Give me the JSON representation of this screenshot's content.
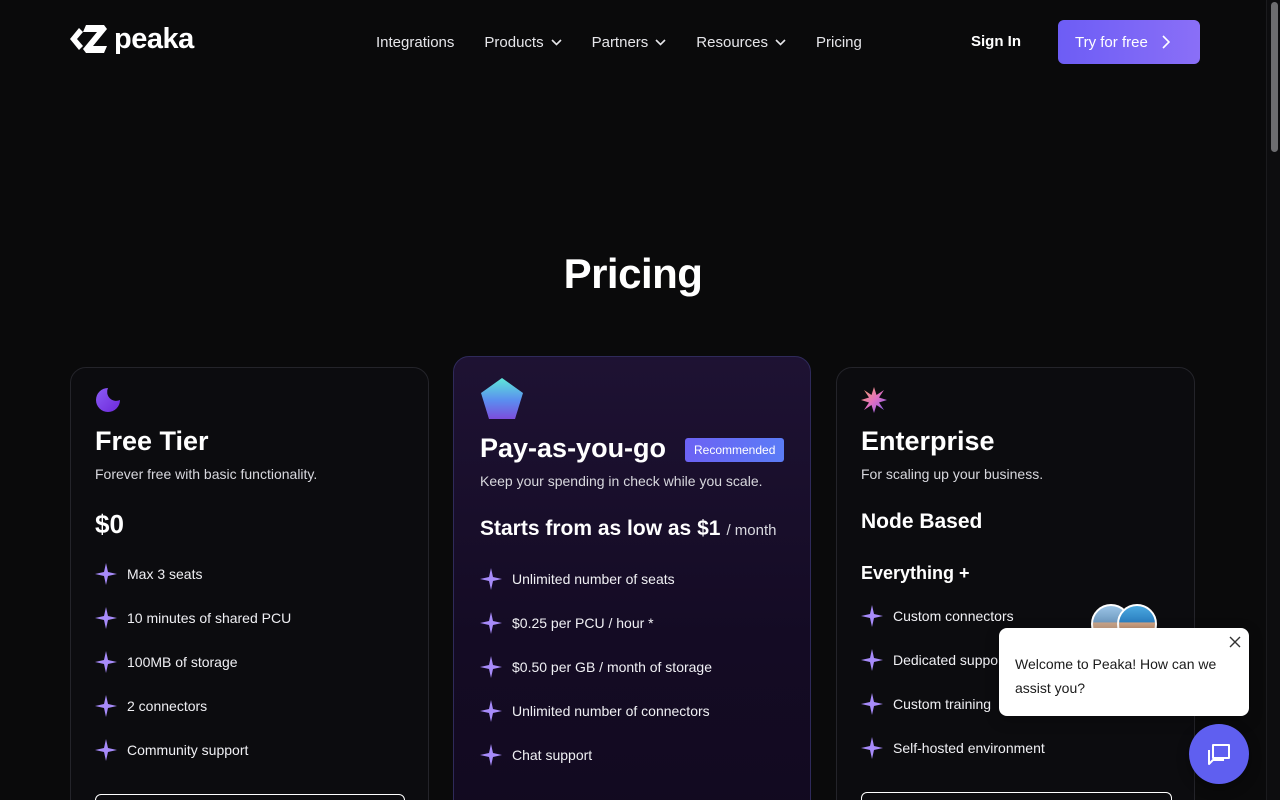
{
  "header": {
    "logo_text": "peaka",
    "nav": [
      {
        "label": "Integrations",
        "has_dropdown": false
      },
      {
        "label": "Products",
        "has_dropdown": true
      },
      {
        "label": "Partners",
        "has_dropdown": true
      },
      {
        "label": "Resources",
        "has_dropdown": true
      },
      {
        "label": "Pricing",
        "has_dropdown": false
      }
    ],
    "sign_in": "Sign In",
    "try_for_free": "Try for free"
  },
  "page_title": "Pricing",
  "plans": {
    "free": {
      "title": "Free Tier",
      "subtitle": "Forever free with basic functionality.",
      "price": "$0",
      "features": [
        "Max 3 seats",
        "10 minutes of shared PCU",
        "100MB of storage",
        "2 connectors",
        "Community support"
      ]
    },
    "payg": {
      "title": "Pay-as-you-go",
      "badge": "Recommended",
      "subtitle": "Keep your spending in check while you scale.",
      "price": "Starts from as low as $1",
      "price_suffix": "/ month",
      "features": [
        "Unlimited number of seats",
        "$0.25 per PCU / hour *",
        "$0.50 per GB / month of storage",
        "Unlimited number of connectors",
        "Chat support"
      ]
    },
    "enterprise": {
      "title": "Enterprise",
      "subtitle": "For scaling up your business.",
      "price": "Node Based",
      "everything_plus": "Everything +",
      "features": [
        "Custom connectors",
        "Dedicated support",
        "Custom training",
        "Self-hosted environment"
      ]
    }
  },
  "chat": {
    "message": "Welcome to Peaka! How can we assist you?"
  },
  "colors": {
    "background": "#0a0a0b",
    "accent": "#6d5df5",
    "badge": "#6c62f4",
    "chat_button": "#5f5ff0"
  }
}
